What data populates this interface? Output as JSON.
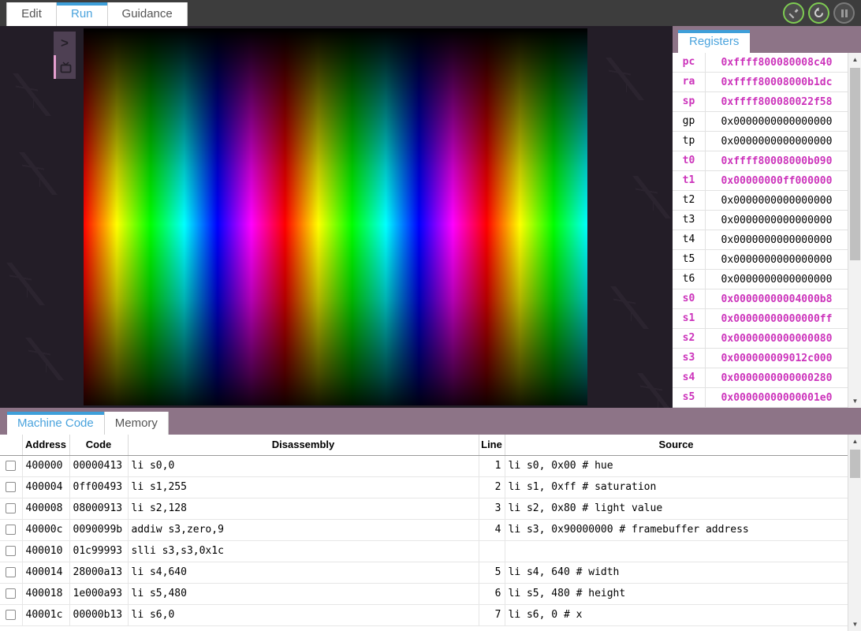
{
  "top_tabs": [
    {
      "label": "Edit",
      "active": false
    },
    {
      "label": "Run",
      "active": true
    },
    {
      "label": "Guidance",
      "active": false
    }
  ],
  "toolbar_buttons": [
    {
      "name": "build-button",
      "icon": "hammer-icon",
      "state": "enabled",
      "color": "#7ecb52"
    },
    {
      "name": "restart-button",
      "icon": "reload-icon",
      "state": "enabled",
      "color": "#7ecb52"
    },
    {
      "name": "pause-button",
      "icon": "pause-icon",
      "state": "disabled",
      "color": "#7a7a7a"
    }
  ],
  "display": {
    "side_buttons": [
      {
        "name": "console-button",
        "icon": "chevron-right-icon",
        "glyph": ">",
        "active": false
      },
      {
        "name": "display-button",
        "icon": "monitor-icon",
        "glyph": "▣",
        "active": true
      }
    ],
    "framebuffer_description": "HSL rainbow gradient, hue sweeping horizontally, lightness peaking at vertical center"
  },
  "registers_panel": {
    "tab_label": "Registers",
    "rows": [
      {
        "name": "pc",
        "value": "0xffff800080008c40",
        "changed": true
      },
      {
        "name": "ra",
        "value": "0xffff80008000b1dc",
        "changed": true
      },
      {
        "name": "sp",
        "value": "0xffff800080022f58",
        "changed": true
      },
      {
        "name": "gp",
        "value": "0x0000000000000000",
        "changed": false
      },
      {
        "name": "tp",
        "value": "0x0000000000000000",
        "changed": false
      },
      {
        "name": "t0",
        "value": "0xffff80008000b090",
        "changed": true
      },
      {
        "name": "t1",
        "value": "0x00000000ff000000",
        "changed": true
      },
      {
        "name": "t2",
        "value": "0x0000000000000000",
        "changed": false
      },
      {
        "name": "t3",
        "value": "0x0000000000000000",
        "changed": false
      },
      {
        "name": "t4",
        "value": "0x0000000000000000",
        "changed": false
      },
      {
        "name": "t5",
        "value": "0x0000000000000000",
        "changed": false
      },
      {
        "name": "t6",
        "value": "0x0000000000000000",
        "changed": false
      },
      {
        "name": "s0",
        "value": "0x00000000004000b8",
        "changed": true
      },
      {
        "name": "s1",
        "value": "0x00000000000000ff",
        "changed": true
      },
      {
        "name": "s2",
        "value": "0x0000000000000080",
        "changed": true
      },
      {
        "name": "s3",
        "value": "0x000000009012c000",
        "changed": true
      },
      {
        "name": "s4",
        "value": "0x0000000000000280",
        "changed": true
      },
      {
        "name": "s5",
        "value": "0x00000000000001e0",
        "changed": true
      }
    ]
  },
  "bottom_panel": {
    "tabs": [
      {
        "label": "Machine Code",
        "active": true
      },
      {
        "label": "Memory",
        "active": false
      }
    ],
    "columns": [
      "",
      "Address",
      "Code",
      "Disassembly",
      "Line",
      "Source"
    ],
    "rows": [
      {
        "address": "400000",
        "code": "00000413",
        "disassembly": "li s0,0",
        "line": "1",
        "source": "li s0, 0x00 # hue"
      },
      {
        "address": "400004",
        "code": "0ff00493",
        "disassembly": "li s1,255",
        "line": "2",
        "source": "li s1, 0xff # saturation"
      },
      {
        "address": "400008",
        "code": "08000913",
        "disassembly": "li s2,128",
        "line": "3",
        "source": "li s2, 0x80 # light value"
      },
      {
        "address": "40000c",
        "code": "0090099b",
        "disassembly": "addiw s3,zero,9",
        "line": "4",
        "source": "li s3, 0x90000000 # framebuffer address"
      },
      {
        "address": "400010",
        "code": "01c99993",
        "disassembly": "slli s3,s3,0x1c",
        "line": "",
        "source": ""
      },
      {
        "address": "400014",
        "code": "28000a13",
        "disassembly": "li s4,640",
        "line": "5",
        "source": "li s4, 640 # width"
      },
      {
        "address": "400018",
        "code": "1e000a93",
        "disassembly": "li s5,480",
        "line": "6",
        "source": "li s5, 480 # height"
      },
      {
        "address": "40001c",
        "code": "00000b13",
        "disassembly": "li s6,0",
        "line": "7",
        "source": "li s6, 0 # x"
      }
    ]
  },
  "colors": {
    "accent_blue": "#3e9fd9",
    "panel_mauve": "#8d7487",
    "topbar_dark": "#3d3d3d",
    "changed_register": "#cc33bb",
    "enabled_button": "#7ecb52"
  }
}
